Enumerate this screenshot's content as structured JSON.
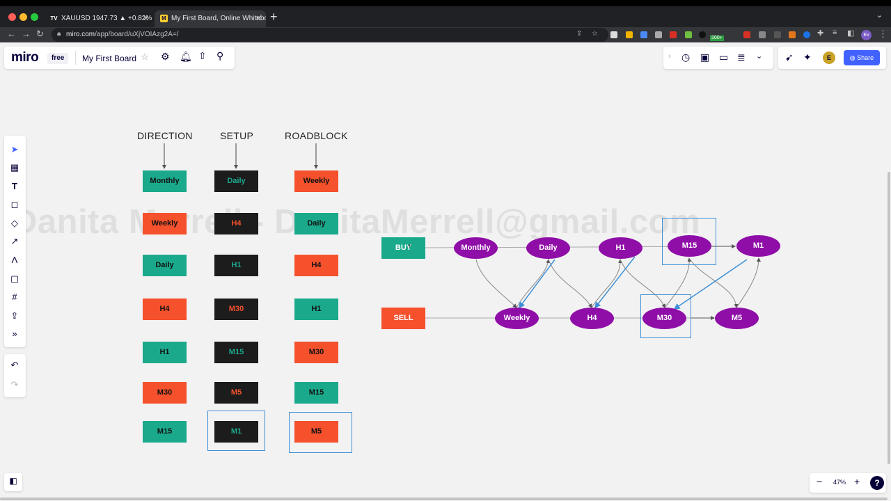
{
  "browser": {
    "tabs": [
      {
        "title": "XAUUSD 1947.73 ▲ +0.82% M",
        "favicon": "TV"
      },
      {
        "title": "My First Board, Online Whitebo",
        "favicon": "M"
      }
    ],
    "url_host": "miro.com",
    "url_path": "/app/board/uXjVOIAzg2A=/",
    "badge_count": "200+",
    "profile_initials": "Ev"
  },
  "miro": {
    "logo": "miro",
    "plan_badge": "free",
    "board_title": "My First Board",
    "share_label": "Share",
    "user_initial": "E",
    "zoom_level": "47%",
    "help_label": "?"
  },
  "columns": {
    "direction": {
      "label": "DIRECTION",
      "cards": [
        "Monthly",
        "Weekly",
        "Daily",
        "H4",
        "H1",
        "M30",
        "M15"
      ]
    },
    "setup": {
      "label": "SETUP",
      "cards": [
        "Daily",
        "H4",
        "H1",
        "M30",
        "M15",
        "M5",
        "M1"
      ]
    },
    "roadblock": {
      "label": "ROADBLOCK",
      "cards": [
        "Weekly",
        "Daily",
        "H4",
        "H1",
        "M30",
        "M15",
        "M5"
      ]
    }
  },
  "flow": {
    "buy_label": "BUY",
    "sell_label": "SELL",
    "top_row": [
      "Monthly",
      "Daily",
      "H1",
      "M15",
      "M1"
    ],
    "bottom_row": [
      "Weekly",
      "H4",
      "M30",
      "M5"
    ]
  },
  "watermark": "Danita Merrell - DanitaMerrell@gmail.com",
  "colors": {
    "teal": "#1ba98c",
    "orange": "#f4512c",
    "black": "#1c1c1c",
    "purple": "#8f0ea8",
    "selection_blue": "#3d8fd6",
    "brand_blue": "#4262ff"
  }
}
